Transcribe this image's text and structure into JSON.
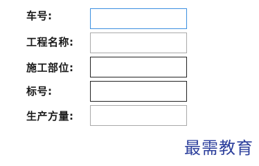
{
  "form": {
    "fields": [
      {
        "label": "车号:",
        "value": ""
      },
      {
        "label": "工程名称:",
        "value": ""
      },
      {
        "label": "施工部位:",
        "value": ""
      },
      {
        "label": "标号:",
        "value": ""
      },
      {
        "label": "生产方量:",
        "value": ""
      }
    ]
  },
  "watermark": {
    "text": "最需教育"
  },
  "colors": {
    "focus_border": "#3b8fe0",
    "default_border": "#a9a9a9",
    "dark_border": "#222222",
    "watermark": "#2c3f9c"
  }
}
